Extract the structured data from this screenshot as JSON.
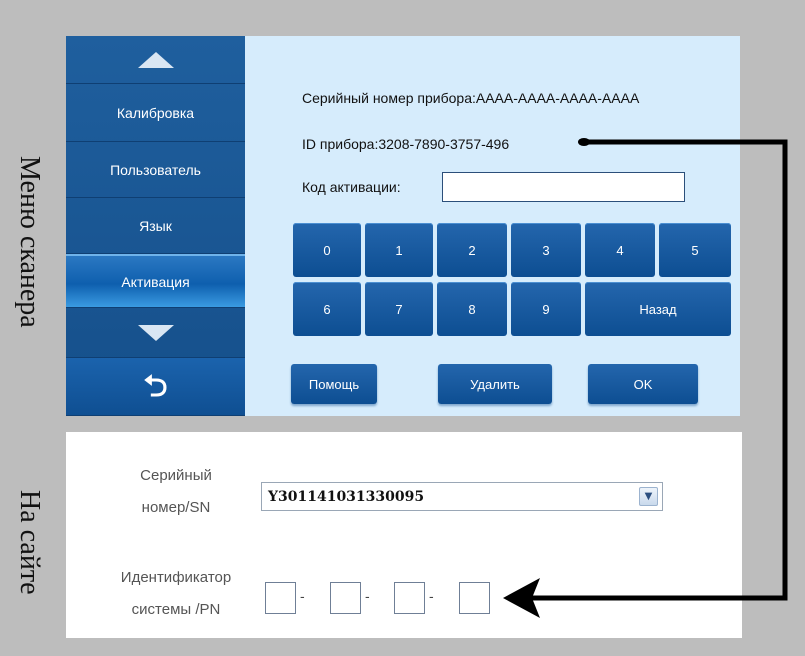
{
  "captions": {
    "scanner_menu": "Меню сканера",
    "on_site": "На сайте"
  },
  "sidebar": {
    "items": [
      {
        "label": "Калибровка"
      },
      {
        "label": "Пользователь"
      },
      {
        "label": "Язык"
      },
      {
        "label": "Активация",
        "active": true
      }
    ],
    "up_icon": "triangle-up-icon",
    "down_icon": "triangle-down-icon",
    "back_icon": "return-arrow-icon",
    "back_glyph": "⮌"
  },
  "activation": {
    "serial_line": "Серийный номер прибора:AAAA-AAAA-AAAA-AAAA",
    "id_line": "ID прибора:3208-7890-3757-496",
    "code_label": "Код активации:",
    "code_value": ""
  },
  "keypad": {
    "row1": [
      "0",
      "1",
      "2",
      "3",
      "4",
      "5"
    ],
    "row2": [
      "6",
      "7",
      "8",
      "9"
    ],
    "back_key": "Назад"
  },
  "buttons": {
    "help": "Помощь",
    "delete": "Удалить",
    "ok": "OK"
  },
  "site": {
    "sn_label_line1": "Серийный",
    "sn_label_line2": "номер/SN",
    "sn_value": "Y301141031330095",
    "pn_label_line1": "Идентификатор",
    "pn_label_line2": "системы /PN",
    "pn_fields": [
      "",
      "",
      "",
      ""
    ],
    "pn_separator": "-"
  },
  "colors": {
    "screen_bg": "#d6ecfc",
    "button_blue": "#1a5da3",
    "page_bg": "#bdbdbd"
  }
}
